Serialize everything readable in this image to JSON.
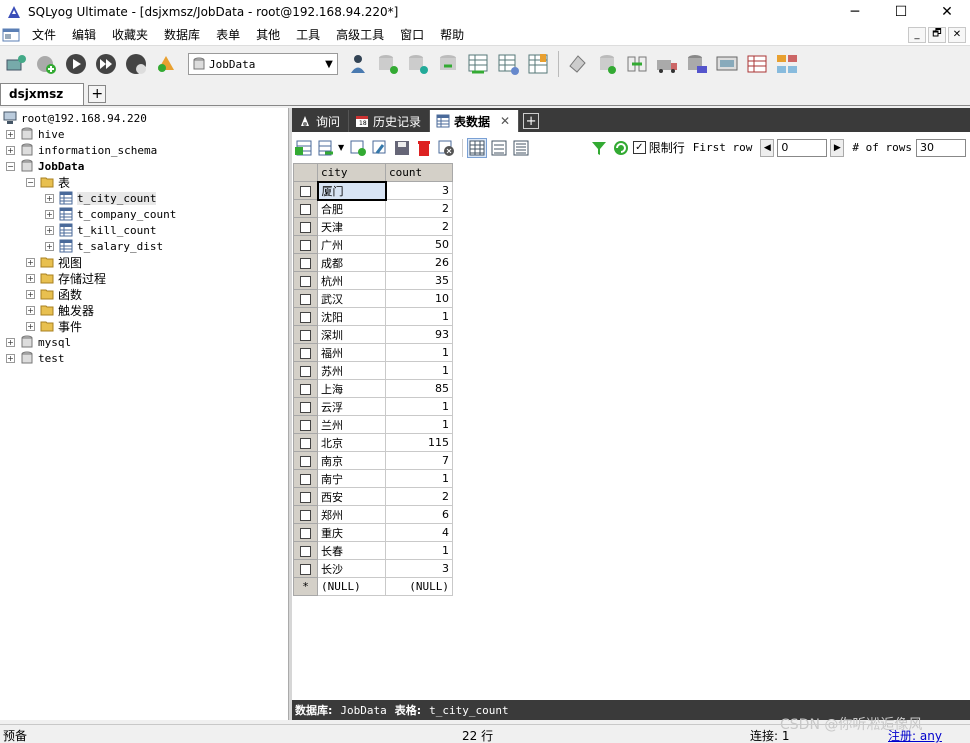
{
  "window": {
    "title": "SQLyog Ultimate - [dsjxmsz/JobData - root@192.168.94.220*]",
    "min": "─",
    "max": "☐",
    "close": "✕"
  },
  "menu": [
    "文件",
    "编辑",
    "收藏夹",
    "数据库",
    "表单",
    "其他",
    "工具",
    "高级工具",
    "窗口",
    "帮助"
  ],
  "mdi_controls": [
    "_",
    "🗗",
    "✕"
  ],
  "toolbar": {
    "database_select": "JobData"
  },
  "connection_tab": {
    "label": "dsjxmsz",
    "plus": "+"
  },
  "tree": {
    "root": "root@192.168.94.220",
    "items": [
      {
        "label": "hive",
        "exp": "+"
      },
      {
        "label": "information_schema",
        "exp": "+"
      },
      {
        "label": "JobData",
        "exp": "−"
      },
      {
        "label": "表",
        "exp": "−"
      },
      {
        "label": "t_city_count",
        "exp": "+"
      },
      {
        "label": "t_company_count",
        "exp": "+"
      },
      {
        "label": "t_kill_count",
        "exp": "+"
      },
      {
        "label": "t_salary_dist",
        "exp": "+"
      },
      {
        "label": "视图",
        "exp": "+"
      },
      {
        "label": "存储过程",
        "exp": "+"
      },
      {
        "label": "函数",
        "exp": "+"
      },
      {
        "label": "触发器",
        "exp": "+"
      },
      {
        "label": "事件",
        "exp": "+"
      },
      {
        "label": "mysql",
        "exp": "+"
      },
      {
        "label": "test",
        "exp": "+"
      }
    ]
  },
  "result_tabs": [
    {
      "label": "询问"
    },
    {
      "label": "历史记录"
    },
    {
      "label": "表数据",
      "close": "✕"
    }
  ],
  "result_tab_plus": "+",
  "grid_toolbar": {
    "limit_checkbox_label": "限制行",
    "limit_checked": "✓",
    "first_row_label": "First row",
    "first_row_value": "0",
    "rows_label": "# of rows",
    "rows_value": "30",
    "prev": "◀",
    "next": "▶"
  },
  "grid": {
    "columns": [
      "city",
      "count"
    ],
    "rows": [
      [
        "厦门",
        "3"
      ],
      [
        "合肥",
        "2"
      ],
      [
        "天津",
        "2"
      ],
      [
        "广州",
        "50"
      ],
      [
        "成都",
        "26"
      ],
      [
        "杭州",
        "35"
      ],
      [
        "武汉",
        "10"
      ],
      [
        "沈阳",
        "1"
      ],
      [
        "深圳",
        "93"
      ],
      [
        "福州",
        "1"
      ],
      [
        "苏州",
        "1"
      ],
      [
        "上海",
        "85"
      ],
      [
        "云浮",
        "1"
      ],
      [
        "兰州",
        "1"
      ],
      [
        "北京",
        "115"
      ],
      [
        "南京",
        "7"
      ],
      [
        "南宁",
        "1"
      ],
      [
        "西安",
        "2"
      ],
      [
        "郑州",
        "6"
      ],
      [
        "重庆",
        "4"
      ],
      [
        "长春",
        "1"
      ],
      [
        "长沙",
        "3"
      ]
    ],
    "new_row": {
      "marker": "*",
      "city": "(NULL)",
      "count": "(NULL)"
    }
  },
  "info_bar": {
    "db_label": "数据库:",
    "db_value": "JobData",
    "table_label": "表格:",
    "table_value": "t_city_count"
  },
  "status_bar": {
    "left": "预备",
    "rows": "22 行",
    "connection": "连接: 1",
    "register": "注册: any"
  },
  "watermark": "CSDN @你听凇逅像风"
}
